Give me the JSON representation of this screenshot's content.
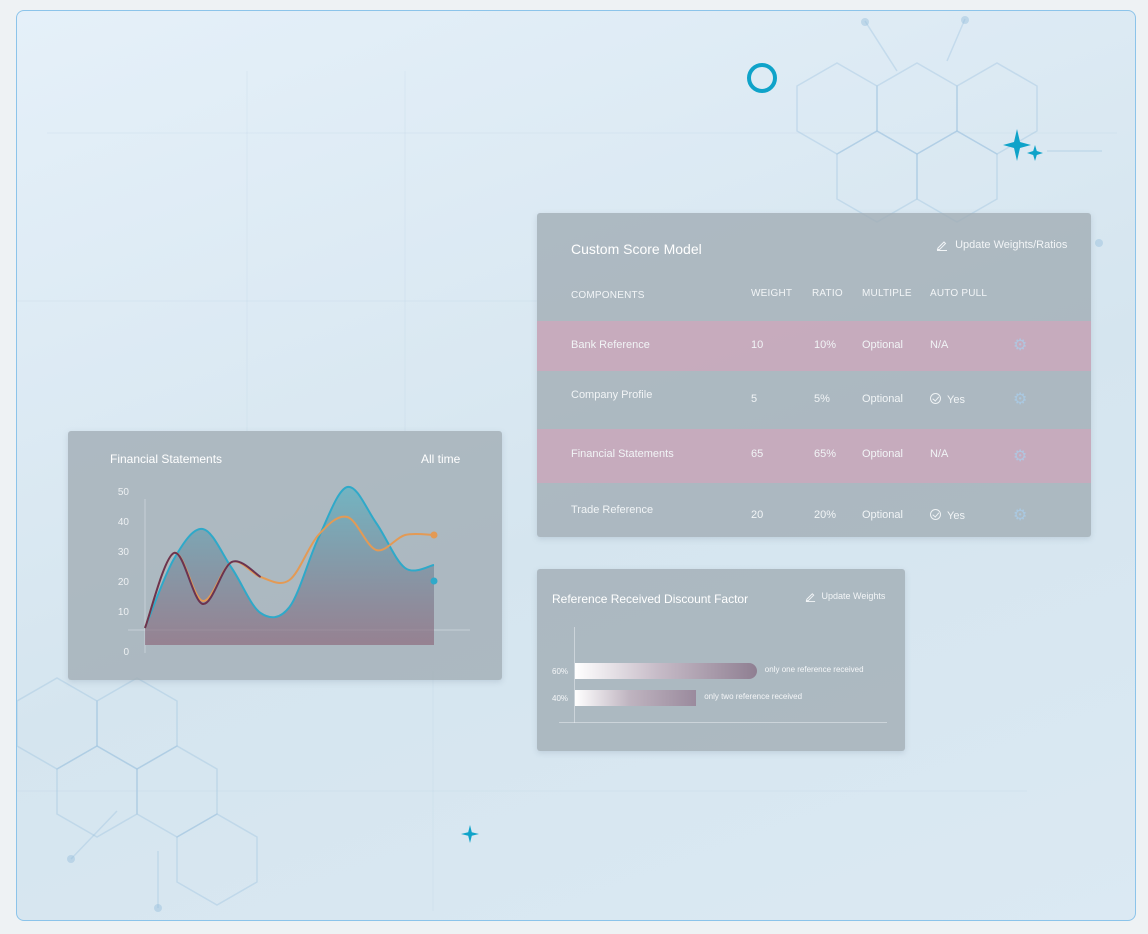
{
  "score_model": {
    "title": "Custom Score Model",
    "update_link": "Update Weights/Ratios",
    "columns": [
      "COMPONENTS",
      "WEIGHT",
      "RATIO",
      "MULTIPLE",
      "AUTO PULL"
    ],
    "rows": [
      {
        "component": "Bank Reference",
        "weight": "10",
        "ratio": "10%",
        "multiple": "Optional",
        "auto_pull": "N/A",
        "checked": false,
        "highlight": true
      },
      {
        "component": "Company Profile",
        "weight": "5",
        "ratio": "5%",
        "multiple": "Optional",
        "auto_pull": "Yes",
        "checked": true,
        "highlight": false
      },
      {
        "component": "Financial Statements",
        "weight": "65",
        "ratio": "65%",
        "multiple": "Optional",
        "auto_pull": "N/A",
        "checked": false,
        "highlight": true
      },
      {
        "component": "Trade Reference",
        "weight": "20",
        "ratio": "20%",
        "multiple": "Optional",
        "auto_pull": "Yes",
        "checked": true,
        "highlight": false
      }
    ]
  },
  "financial_chart": {
    "title": "Financial Statements",
    "period": "All time"
  },
  "chart_data": {
    "type": "line",
    "title": "Financial Statements",
    "y_ticks": [
      "50",
      "40",
      "30",
      "20",
      "10",
      "0"
    ],
    "ylim": [
      0,
      50
    ],
    "grid": false,
    "series": [
      {
        "color": "#2fa9c9",
        "x": [
          0,
          1,
          2,
          3,
          4,
          5,
          6,
          7,
          8,
          9,
          10
        ],
        "values": [
          5,
          28,
          38,
          25,
          10,
          12,
          35,
          52,
          40,
          25,
          26
        ]
      },
      {
        "color": "#e39a55",
        "x": [
          0,
          1,
          2,
          3,
          4,
          5,
          6,
          7,
          8,
          9,
          10
        ],
        "values": [
          5,
          30,
          14,
          27,
          22,
          21,
          36,
          42,
          31,
          36,
          36
        ]
      },
      {
        "color": "#6b3350",
        "x": [
          0,
          1,
          2,
          3,
          4
        ],
        "values": [
          5,
          30,
          13,
          27,
          22
        ]
      }
    ]
  },
  "discount_factor": {
    "title": "Reference Received Discount Factor",
    "update_link": "Update Weights",
    "bars": [
      {
        "label": "60%",
        "value": 60,
        "note": "only one reference received"
      },
      {
        "label": "40%",
        "value": 40,
        "note": "only two reference received"
      }
    ]
  },
  "colors": {
    "accent": "#0fa3c9",
    "frame_border": "#8cc4ea",
    "row_highlight": "#cda8bc"
  }
}
